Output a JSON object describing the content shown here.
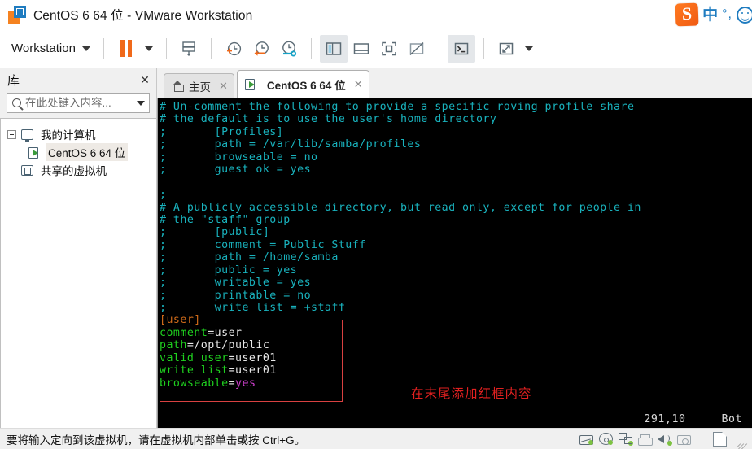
{
  "window": {
    "title": "CentOS 6 64 位 - VMware Workstation",
    "logo_icon": "vmware-logo-icon",
    "minimize_label": "—"
  },
  "ime": {
    "logo_icon": "sogou-logo-icon",
    "logo_letter": "S",
    "mode_label": "中",
    "punct_label": "°,",
    "smiley_icon": "smiley-icon"
  },
  "toolbar": {
    "menu_label": "Workstation",
    "pause_icon": "pause-icon",
    "buttons": [
      {
        "name": "suspend-button",
        "icon": "suspend-icon"
      },
      {
        "name": "take-snapshot-button",
        "icon": "snapshot-add-clock-icon"
      },
      {
        "name": "revert-snapshot-button",
        "icon": "snapshot-revert-clock-icon"
      },
      {
        "name": "snapshot-manager-button",
        "icon": "snapshot-manager-wrench-clock-icon"
      },
      {
        "name": "show-library-button",
        "icon": "library-panel-icon",
        "active": true
      },
      {
        "name": "show-thumbnail-bar-button",
        "icon": "thumbnail-bar-icon"
      },
      {
        "name": "full-screen-button",
        "icon": "fullscreen-icon"
      },
      {
        "name": "unity-mode-button",
        "icon": "unity-mode-off-icon"
      },
      {
        "name": "console-button",
        "icon": "console-prompt-icon",
        "active": true
      },
      {
        "name": "stretch-guest-button",
        "icon": "stretch-arrows-icon"
      }
    ]
  },
  "sidebar": {
    "title": "库",
    "close_label": "✕",
    "search": {
      "placeholder": "在此处键入内容...",
      "value": "",
      "icon": "search-icon"
    },
    "tree": [
      {
        "label": "我的计算机",
        "icon": "my-computer-icon",
        "expanded": true,
        "selected": false
      },
      {
        "label": "CentOS 6 64 位",
        "icon": "vm-powered-on-icon",
        "indent": true,
        "selected": true
      },
      {
        "label": "共享的虚拟机",
        "icon": "shared-vms-icon",
        "selected": false
      }
    ]
  },
  "tabs": [
    {
      "label": "主页",
      "icon": "home-icon",
      "active": false,
      "close_label": "✕"
    },
    {
      "label": "CentOS 6 64 位",
      "icon": "vm-powered-on-icon",
      "active": true,
      "close_label": "✕"
    }
  ],
  "terminal": {
    "lines": [
      [
        {
          "t": "# Un-comment the following to provide a specific roving profile share",
          "c": "cyan"
        }
      ],
      [
        {
          "t": "# the default is to use the user's home directory",
          "c": "cyan"
        }
      ],
      [
        {
          "t": ";       [Profiles]",
          "c": "cyan"
        }
      ],
      [
        {
          "t": ";       path = /var/lib/samba/profiles",
          "c": "cyan"
        }
      ],
      [
        {
          "t": ";       browseable = no",
          "c": "cyan"
        }
      ],
      [
        {
          "t": ";       guest ok = yes",
          "c": "cyan"
        }
      ],
      [
        {
          "t": "",
          "c": "cyan"
        }
      ],
      [
        {
          "t": ";",
          "c": "cyan"
        }
      ],
      [
        {
          "t": "# A publicly accessible directory, but read only, except for people in",
          "c": "cyan"
        }
      ],
      [
        {
          "t": "# the \"staff\" group",
          "c": "cyan"
        }
      ],
      [
        {
          "t": ";       [public]",
          "c": "cyan"
        }
      ],
      [
        {
          "t": ";       comment = Public Stuff",
          "c": "cyan"
        }
      ],
      [
        {
          "t": ";       path = /home/samba",
          "c": "cyan"
        }
      ],
      [
        {
          "t": ";       public = yes",
          "c": "cyan"
        }
      ],
      [
        {
          "t": ";       writable = yes",
          "c": "cyan"
        }
      ],
      [
        {
          "t": ";       printable = no",
          "c": "cyan"
        }
      ],
      [
        {
          "t": ";       write list = +staff",
          "c": "cyan"
        }
      ],
      [
        {
          "t": "[user]",
          "c": "orange"
        }
      ],
      [
        {
          "t": "comment",
          "c": "green"
        },
        {
          "t": "=user",
          "c": "white"
        }
      ],
      [
        {
          "t": "path",
          "c": "green"
        },
        {
          "t": "=/opt/public",
          "c": "white"
        }
      ],
      [
        {
          "t": "valid user",
          "c": "green"
        },
        {
          "t": "=user01",
          "c": "white"
        }
      ],
      [
        {
          "t": "write list",
          "c": "green"
        },
        {
          "t": "=user01",
          "c": "white"
        }
      ],
      [
        {
          "t": "browseable",
          "c": "green"
        },
        {
          "t": "=",
          "c": "white"
        },
        {
          "t": "yes",
          "c": "magenta"
        }
      ]
    ],
    "annotation": "在末尾添加红框内容",
    "annotation_color": "#e02020",
    "highlight_box_color": "#d94141",
    "vim_position": "291,10",
    "vim_scroll": "Bot",
    "background_color": "#000000"
  },
  "statusbar": {
    "message": "要将输入定向到该虚拟机，请在虚拟机内部单击或按 Ctrl+G。",
    "devices": [
      {
        "name": "hard-disk-icon",
        "connected": true
      },
      {
        "name": "cd-dvd-icon",
        "connected": true
      },
      {
        "name": "network-adapter-icon",
        "connected": true
      },
      {
        "name": "printer-icon",
        "connected": false
      },
      {
        "name": "sound-card-icon",
        "connected": true
      },
      {
        "name": "camera-icon",
        "connected": false
      },
      {
        "name": "removable-device-icon",
        "connected": false
      }
    ]
  }
}
